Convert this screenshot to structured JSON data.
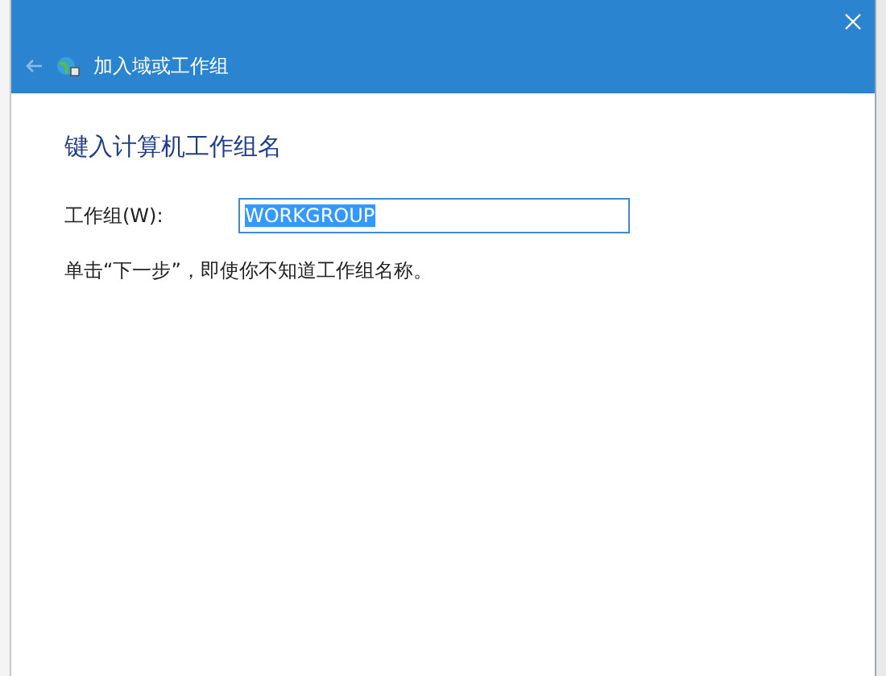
{
  "window": {
    "title": "加入域或工作组",
    "back_enabled": false
  },
  "heading": "键入计算机工作组名",
  "field": {
    "label": "工作组(W):",
    "value": "WORKGROUP",
    "selected": true
  },
  "hint": "单击“下一步”，即使你不知道工作组名称。"
}
